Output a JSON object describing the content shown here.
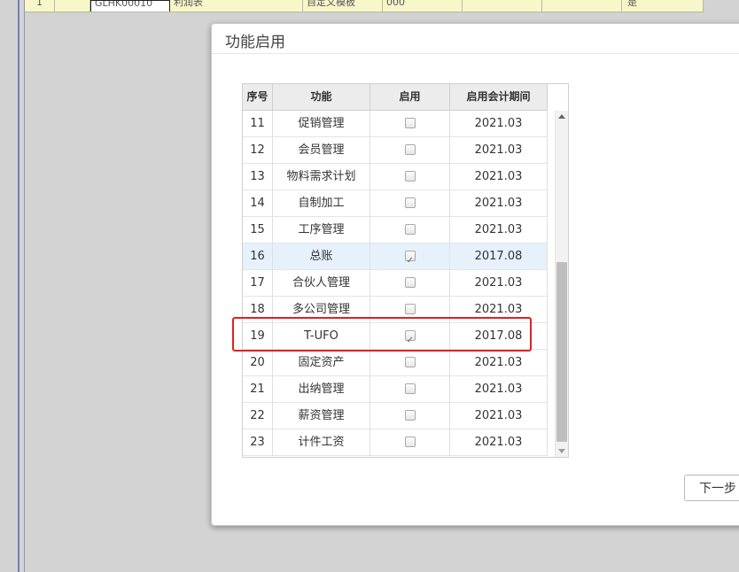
{
  "background": {
    "cells": [
      "1",
      "GLHK00010",
      "利润表",
      "自定义模板",
      "000",
      "是"
    ]
  },
  "dialog": {
    "title": "功能启用",
    "next_label": "下一步"
  },
  "grid": {
    "headers": [
      "序号",
      "功能",
      "启用",
      "启用会计期间"
    ],
    "rows": [
      {
        "no": "11",
        "name": "促销管理",
        "enabled": false,
        "period": "2021.03"
      },
      {
        "no": "12",
        "name": "会员管理",
        "enabled": false,
        "period": "2021.03"
      },
      {
        "no": "13",
        "name": "物料需求计划",
        "enabled": false,
        "period": "2021.03"
      },
      {
        "no": "14",
        "name": "自制加工",
        "enabled": false,
        "period": "2021.03"
      },
      {
        "no": "15",
        "name": "工序管理",
        "enabled": false,
        "period": "2021.03"
      },
      {
        "no": "16",
        "name": "总账",
        "enabled": true,
        "period": "2017.08"
      },
      {
        "no": "17",
        "name": "合伙人管理",
        "enabled": false,
        "period": "2021.03"
      },
      {
        "no": "18",
        "name": "多公司管理",
        "enabled": false,
        "period": "2021.03"
      },
      {
        "no": "19",
        "name": "T-UFO",
        "enabled": true,
        "period": "2017.08"
      },
      {
        "no": "20",
        "name": "固定资产",
        "enabled": false,
        "period": "2021.03"
      },
      {
        "no": "21",
        "name": "出纳管理",
        "enabled": false,
        "period": "2021.03"
      },
      {
        "no": "22",
        "name": "薪资管理",
        "enabled": false,
        "period": "2021.03"
      },
      {
        "no": "23",
        "name": "计件工资",
        "enabled": false,
        "period": "2021.03"
      }
    ]
  },
  "colors": {
    "highlight": "#e32020",
    "selected_row": "#e6f1fb"
  },
  "icons": {
    "scroll_up": "triangle-up-icon",
    "scroll_down": "triangle-down-icon",
    "checkbox": "checkbox-icon"
  }
}
